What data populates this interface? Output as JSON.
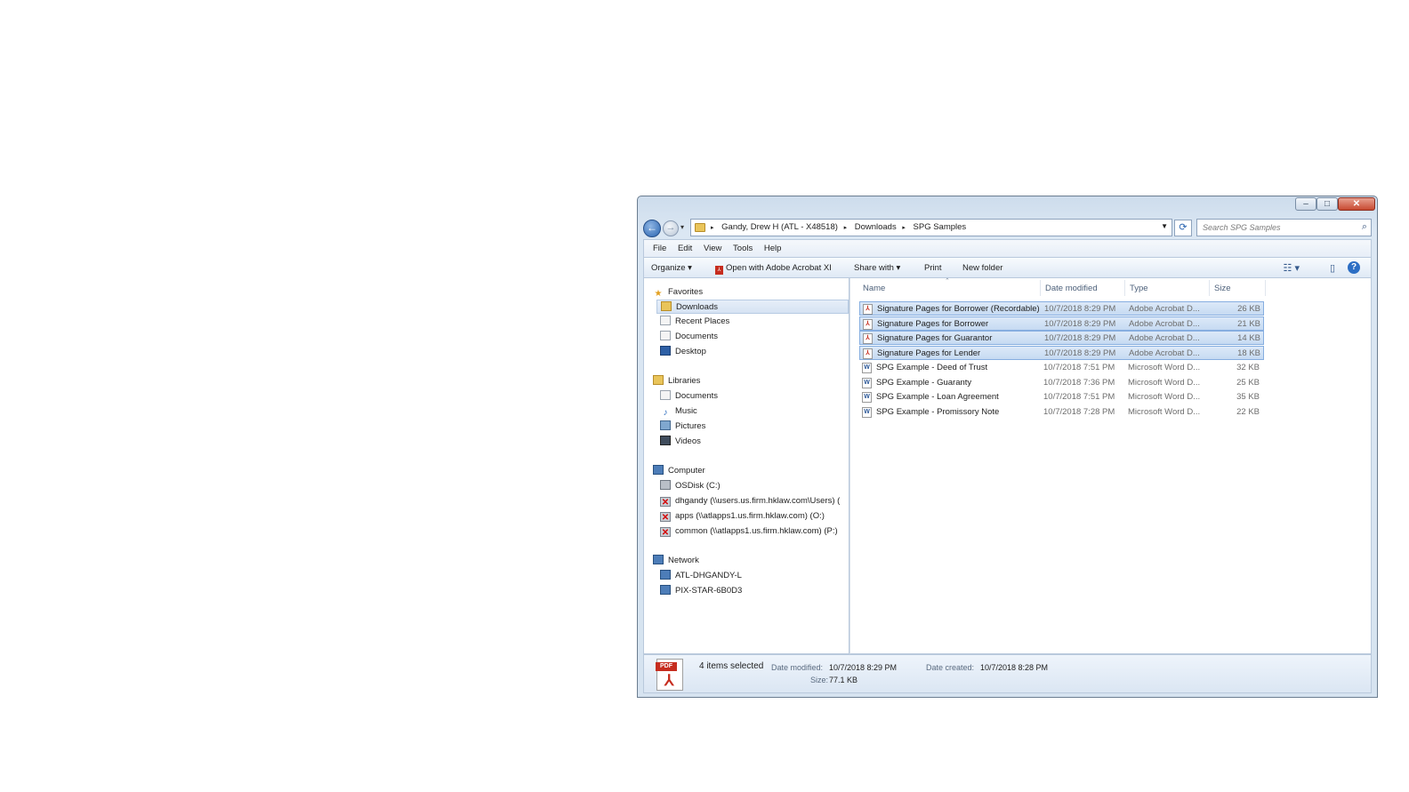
{
  "window": {
    "controls": {
      "minimize": "‒",
      "maximize": "□",
      "close": "✕"
    },
    "address": {
      "crumbs": [
        "Gandy, Drew H (ATL - X48518)",
        "Downloads",
        "SPG Samples"
      ],
      "separator": "▸"
    },
    "search_placeholder": "Search SPG Samples",
    "menu": [
      "File",
      "Edit",
      "View",
      "Tools",
      "Help"
    ],
    "toolbar": {
      "organize": "Organize ▾",
      "open_with": "Open with Adobe Acrobat XI",
      "share_with": "Share with ▾",
      "print": "Print",
      "new_folder": "New folder",
      "help": "?"
    },
    "nav": {
      "favorites": {
        "label": "Favorites",
        "items": [
          "Downloads",
          "Recent Places",
          "Documents",
          "Desktop"
        ]
      },
      "libraries": {
        "label": "Libraries",
        "items": [
          "Documents",
          "Music",
          "Pictures",
          "Videos"
        ]
      },
      "computer": {
        "label": "Computer",
        "items": [
          "OSDisk (C:)",
          "dhgandy (\\\\users.us.firm.hklaw.com\\Users) (",
          "apps (\\\\atlapps1.us.firm.hklaw.com) (O:)",
          "common (\\\\atlapps1.us.firm.hklaw.com) (P:)"
        ]
      },
      "network": {
        "label": "Network",
        "items": [
          "ATL-DHGANDY-L",
          "PIX-STAR-6B0D3"
        ]
      }
    },
    "columns": {
      "name": "Name",
      "date": "Date modified",
      "type": "Type",
      "size": "Size"
    },
    "files": [
      {
        "name": "Signature Pages for Borrower (Recordable)",
        "date": "10/7/2018 8:29 PM",
        "type": "Adobe Acrobat D...",
        "size": "26 KB",
        "kind": "pdf",
        "selected": true
      },
      {
        "name": "Signature Pages for Borrower",
        "date": "10/7/2018 8:29 PM",
        "type": "Adobe Acrobat D...",
        "size": "21 KB",
        "kind": "pdf",
        "selected": true
      },
      {
        "name": "Signature Pages for Guarantor",
        "date": "10/7/2018 8:29 PM",
        "type": "Adobe Acrobat D...",
        "size": "14 KB",
        "kind": "pdf",
        "selected": true
      },
      {
        "name": "Signature Pages for Lender",
        "date": "10/7/2018 8:29 PM",
        "type": "Adobe Acrobat D...",
        "size": "18 KB",
        "kind": "pdf",
        "selected": true
      },
      {
        "name": "SPG Example - Deed of Trust",
        "date": "10/7/2018 7:51 PM",
        "type": "Microsoft Word D...",
        "size": "32 KB",
        "kind": "doc",
        "selected": false
      },
      {
        "name": "SPG Example - Guaranty",
        "date": "10/7/2018 7:36 PM",
        "type": "Microsoft Word D...",
        "size": "25 KB",
        "kind": "doc",
        "selected": false
      },
      {
        "name": "SPG Example - Loan Agreement",
        "date": "10/7/2018 7:51 PM",
        "type": "Microsoft Word D...",
        "size": "35 KB",
        "kind": "doc",
        "selected": false
      },
      {
        "name": "SPG Example - Promissory Note",
        "date": "10/7/2018 7:28 PM",
        "type": "Microsoft Word D...",
        "size": "22 KB",
        "kind": "doc",
        "selected": false
      }
    ],
    "details": {
      "count": "4 items selected",
      "date_modified_label": "Date modified:",
      "date_modified": "10/7/2018 8:29 PM",
      "date_created_label": "Date created:",
      "date_created": "10/7/2018 8:28 PM",
      "size_label": "Size:",
      "size": "77.1 KB",
      "icon_text": "PDF"
    }
  }
}
